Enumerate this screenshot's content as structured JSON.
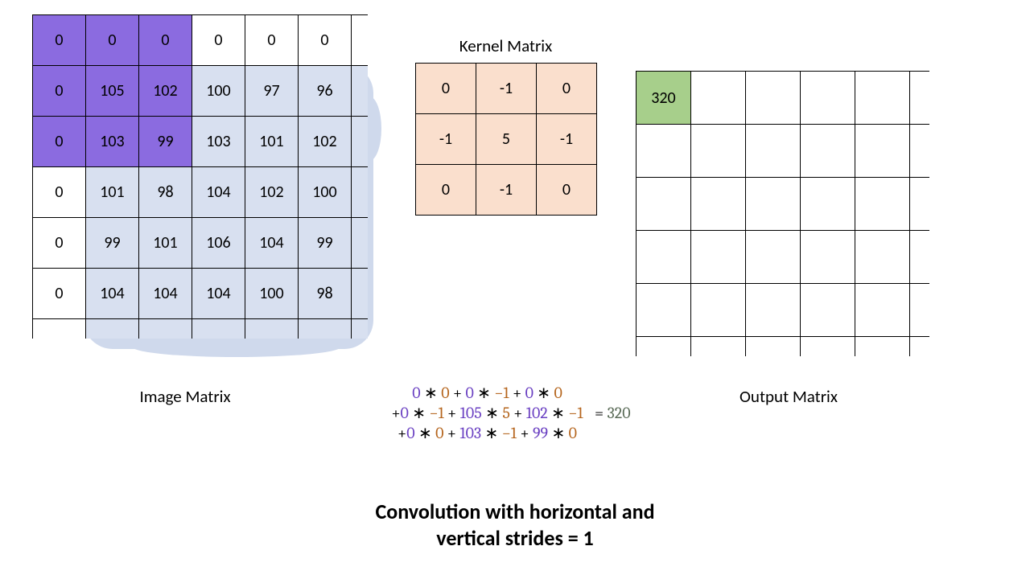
{
  "image_matrix": {
    "label": "Image Matrix",
    "rows": [
      [
        "0",
        "0",
        "0",
        "0",
        "0",
        "0"
      ],
      [
        "0",
        "105",
        "102",
        "100",
        "97",
        "96"
      ],
      [
        "0",
        "103",
        "99",
        "103",
        "101",
        "102"
      ],
      [
        "0",
        "101",
        "98",
        "104",
        "102",
        "100"
      ],
      [
        "0",
        "99",
        "101",
        "106",
        "104",
        "99"
      ],
      [
        "0",
        "104",
        "104",
        "104",
        "100",
        "98"
      ]
    ],
    "highlight_purple": [
      [
        0,
        0
      ],
      [
        0,
        1
      ],
      [
        0,
        2
      ],
      [
        1,
        0
      ],
      [
        1,
        1
      ],
      [
        1,
        2
      ],
      [
        2,
        0
      ],
      [
        2,
        1
      ],
      [
        2,
        2
      ]
    ],
    "blue_region_start_row": 1,
    "blue_region_start_col": 1
  },
  "kernel": {
    "title": "Kernel Matrix",
    "rows": [
      [
        "0",
        "-1",
        "0"
      ],
      [
        "-1",
        "5",
        "-1"
      ],
      [
        "0",
        "-1",
        "0"
      ]
    ]
  },
  "output_matrix": {
    "label": "Output Matrix",
    "value": "320"
  },
  "equation": {
    "lines": [
      [
        {
          "t": "img",
          "v": "0"
        },
        {
          "t": "op",
          "v": " "
        },
        {
          "t": "op",
          "v": "∗"
        },
        {
          "t": "op",
          "v": " "
        },
        {
          "t": "ker",
          "v": "0"
        },
        {
          "t": "op",
          "v": " + "
        },
        {
          "t": "img",
          "v": "0"
        },
        {
          "t": "op",
          "v": " ∗ "
        },
        {
          "t": "ker",
          "v": "−1"
        },
        {
          "t": "op",
          "v": " + "
        },
        {
          "t": "img",
          "v": "0"
        },
        {
          "t": "op",
          "v": " ∗ "
        },
        {
          "t": "ker",
          "v": "0"
        }
      ],
      [
        {
          "t": "op",
          "v": "+"
        },
        {
          "t": "img",
          "v": "0"
        },
        {
          "t": "op",
          "v": " ∗ "
        },
        {
          "t": "ker",
          "v": "−1"
        },
        {
          "t": "op",
          "v": " + "
        },
        {
          "t": "img",
          "v": "105"
        },
        {
          "t": "op",
          "v": " ∗ "
        },
        {
          "t": "ker",
          "v": "5"
        },
        {
          "t": "op",
          "v": " + "
        },
        {
          "t": "img",
          "v": "102"
        },
        {
          "t": "op",
          "v": " ∗ "
        },
        {
          "t": "ker",
          "v": "−1"
        }
      ],
      [
        {
          "t": "op",
          "v": "+"
        },
        {
          "t": "img",
          "v": "0"
        },
        {
          "t": "op",
          "v": " ∗ "
        },
        {
          "t": "ker",
          "v": "0"
        },
        {
          "t": "op",
          "v": " + "
        },
        {
          "t": "img",
          "v": "103"
        },
        {
          "t": "op",
          "v": " ∗ "
        },
        {
          "t": "ker",
          "v": "−1"
        },
        {
          "t": "op",
          "v": " + "
        },
        {
          "t": "img",
          "v": "99"
        },
        {
          "t": "op",
          "v": " ∗ "
        },
        {
          "t": "ker",
          "v": "0"
        }
      ]
    ],
    "result_prefix": "= ",
    "result": "320"
  },
  "caption": {
    "line1": "Convolution with horizontal and",
    "line2": "vertical strides = 1"
  }
}
